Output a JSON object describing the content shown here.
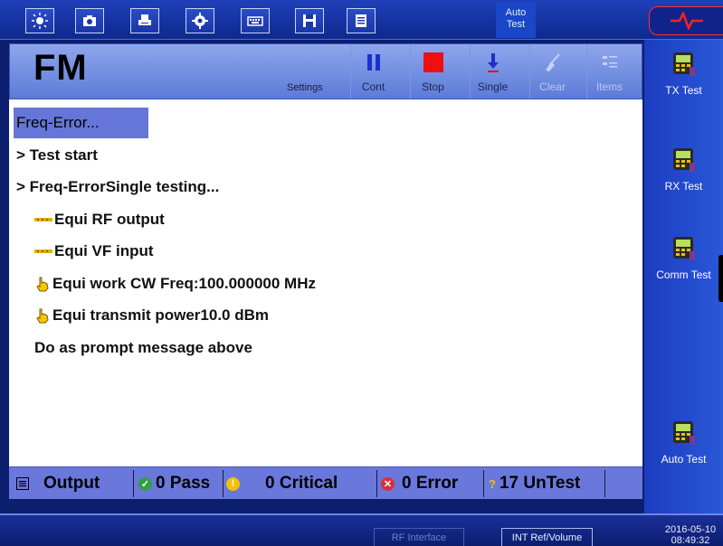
{
  "toolbar": {
    "buttons": [
      "brightness-icon",
      "camera-icon",
      "print-icon",
      "gear-icon",
      "keyboard-icon",
      "save-icon",
      "document-icon"
    ],
    "auto_test_label": "Auto\nTest"
  },
  "alarm": {
    "icon": "rf-warning-icon",
    "color": "#ff2020"
  },
  "header": {
    "mode": "FM",
    "settings_label": "Settings",
    "controls": [
      {
        "label": "Cont",
        "icon": "pause-icon",
        "enabled": true
      },
      {
        "label": "Stop",
        "icon": "stop-icon",
        "enabled": true
      },
      {
        "label": "Single",
        "icon": "single-step-icon",
        "enabled": true
      },
      {
        "label": "Clear",
        "icon": "broom-icon",
        "enabled": false
      },
      {
        "label": "Items",
        "icon": "list-icon",
        "enabled": false
      }
    ]
  },
  "tab": {
    "label": "Freq-Error..."
  },
  "log": {
    "lines": [
      {
        "text": "> Test start",
        "icon": null
      },
      {
        "text": "> Freq-ErrorSingle testing...",
        "icon": null
      },
      {
        "text": "Equi RF output",
        "icon": "connector-icon"
      },
      {
        "text": "Equi VF input",
        "icon": "connector-icon"
      },
      {
        "text": "Equi work CW Freq:100.000000 MHz",
        "icon": "hand-icon"
      },
      {
        "text": "Equi transmit power10.0 dBm",
        "icon": "hand-icon"
      },
      {
        "text": "Do as prompt message above",
        "icon": null
      }
    ]
  },
  "status": {
    "output_label": "Output",
    "pass": "0 Pass",
    "critical": "0 Critical",
    "error": "0 Error",
    "untest": "17 UnTest"
  },
  "sidebar": {
    "items": [
      {
        "label": "TX Test"
      },
      {
        "label": "RX Test"
      },
      {
        "label": "Comm Test"
      },
      {
        "label": "Auto Test"
      }
    ]
  },
  "bottom": {
    "rf_interface_label": "RF Interface",
    "int_ref_label": "INT Ref/Volume",
    "date": "2016-05-10",
    "time": "08:49:32"
  },
  "colors": {
    "accent_blue": "#1c3cc0",
    "status_bar": "#6a78db",
    "pass": "#2ea043",
    "critical": "#f2c200",
    "error": "#d6303a",
    "untest": "#f2c200"
  }
}
